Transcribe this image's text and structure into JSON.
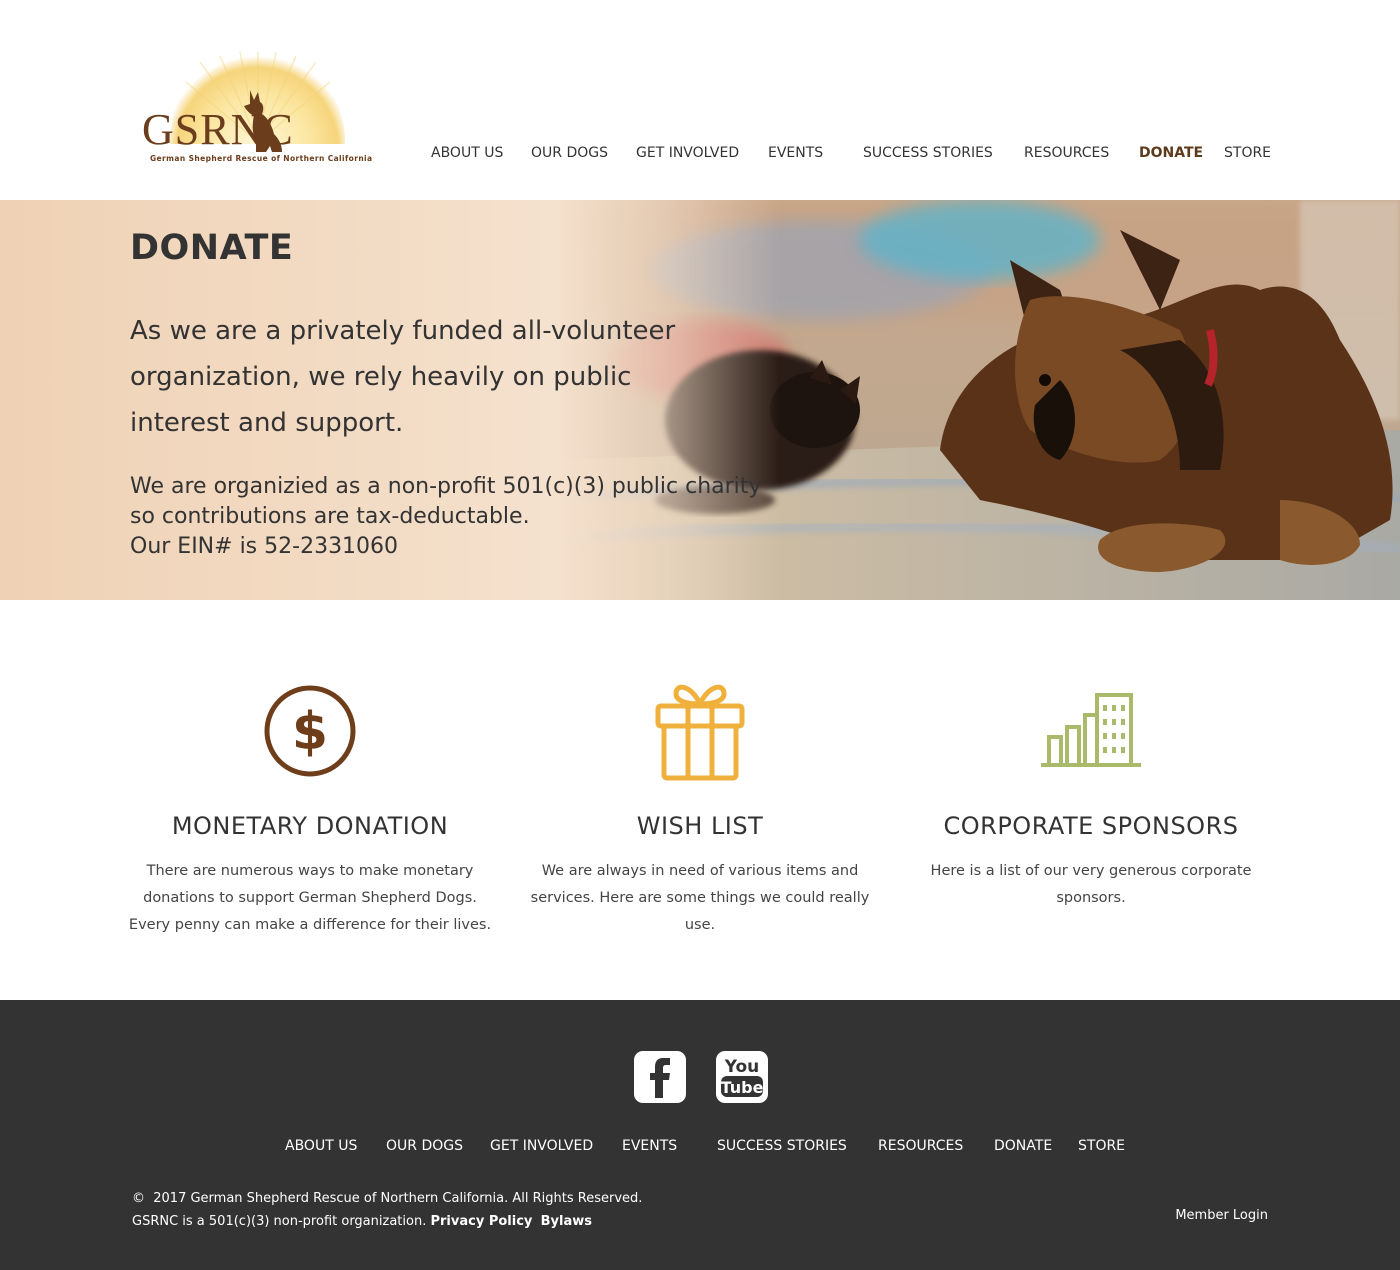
{
  "brand": {
    "logo_text": "GSRNC",
    "logo_subtitle": "German Shepherd Rescue of Northern California"
  },
  "nav": {
    "items": [
      {
        "label": "ABOUT US"
      },
      {
        "label": "OUR DOGS"
      },
      {
        "label": "GET INVOLVED"
      },
      {
        "label": "EVENTS"
      },
      {
        "label": "SUCCESS STORIES"
      },
      {
        "label": "RESOURCES"
      },
      {
        "label": "DONATE",
        "active": true
      },
      {
        "label": "STORE"
      }
    ]
  },
  "hero": {
    "title": "DONATE",
    "lead": "As we are a privately funded  all-volunteer organization, we rely heavily on public interest and support.",
    "line1": "We are organizied as a non-profit 501(c)(3) public charity",
    "line2": "so contributions are tax-deductable.",
    "line3": "Our EIN# is 52-2331060"
  },
  "features": [
    {
      "icon": "dollar-circle-icon",
      "title": "MONETARY DONATION",
      "text": "There are numerous ways to make monetary donations to support German Shepherd Dogs. Every penny can make a difference for their lives."
    },
    {
      "icon": "gift-icon",
      "title": "WISH LIST",
      "text": "We are always in need of various items and services. Here are some things we could really use."
    },
    {
      "icon": "buildings-icon",
      "title": "CORPORATE SPONSORS",
      "text": "Here is a list of our very generous corporate sponsors."
    }
  ],
  "footer": {
    "social": [
      "facebook-icon",
      "youtube-icon"
    ],
    "youtube_top": "You",
    "youtube_bottom": "Tube",
    "nav": [
      {
        "label": "ABOUT US"
      },
      {
        "label": "OUR DOGS"
      },
      {
        "label": "GET INVOLVED"
      },
      {
        "label": "EVENTS"
      },
      {
        "label": "SUCCESS STORIES"
      },
      {
        "label": "RESOURCES"
      },
      {
        "label": "DONATE"
      },
      {
        "label": "STORE"
      }
    ],
    "copyright_symbol": "©",
    "copyright": "2017 German Shepherd Rescue of Northern California. All Rights Reserved.",
    "nonprofit": "GSRNC is a 501(c)(3) non-profit organization.",
    "privacy": "Privacy Policy",
    "bylaws": "Bylaws",
    "member_login": "Member Login"
  },
  "colors": {
    "brand_brown": "#6b3d1c",
    "dollar_icon": "#6e3d19",
    "gift_icon": "#f0b03c",
    "building_icon": "#a9bb6a",
    "footer_bg": "#333333"
  }
}
